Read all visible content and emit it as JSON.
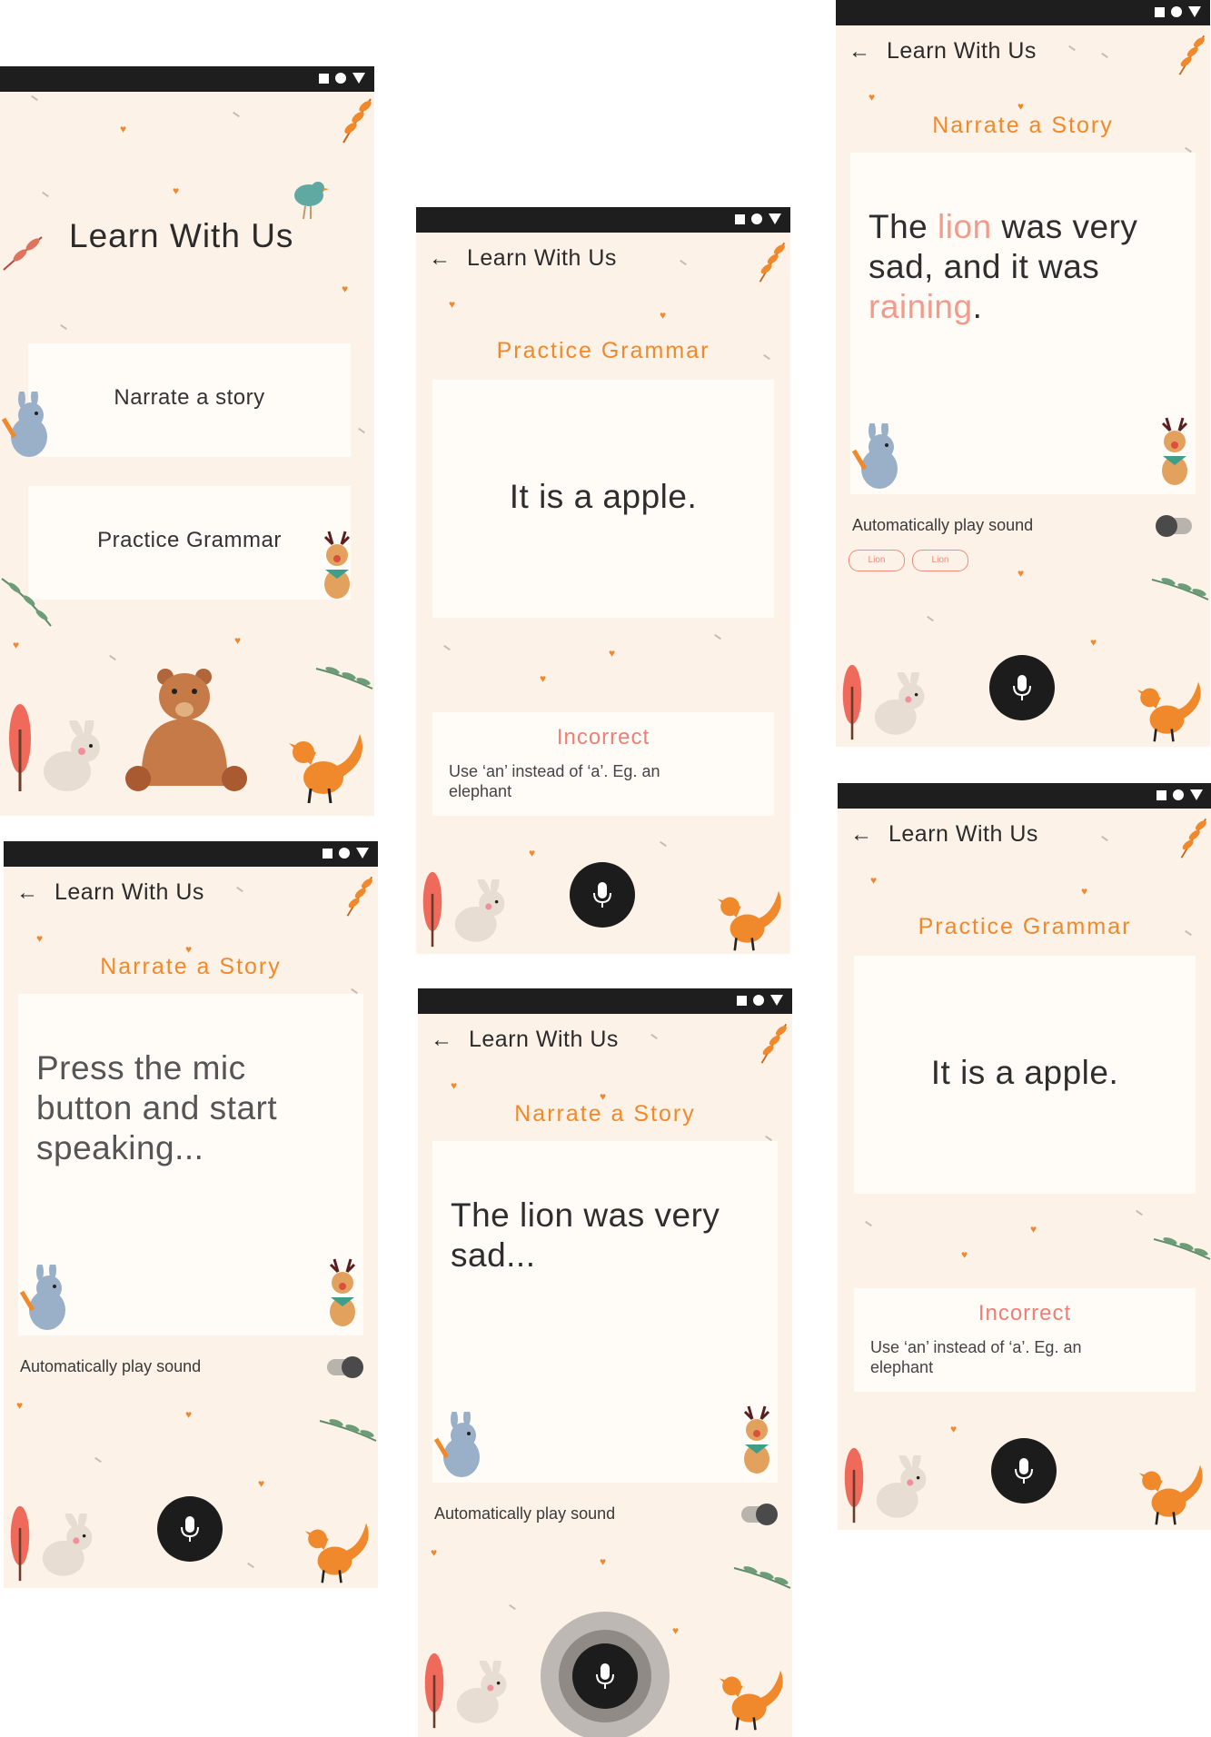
{
  "app_title": "Learn With Us",
  "home": {
    "title": "Learn With Us",
    "menu": [
      "Narrate a story",
      "Practice Grammar"
    ]
  },
  "narrate_title": "Narrate a Story",
  "grammar_title": "Practice Grammar",
  "narrate_prompt": "Press the mic button and start speaking...",
  "narrate_partial": "The lion was very sad...",
  "narrate_full": {
    "part1": "The ",
    "word1": "lion",
    "part2": " was very sad, and it was ",
    "word2": "raining",
    "part3": "."
  },
  "chips": [
    "Lion",
    "Lion"
  ],
  "grammar_sentence": "It is a apple.",
  "feedback": {
    "title": "Incorrect",
    "body": "Use ‘an’ instead of ‘a’. Eg. an elephant"
  },
  "toggle_label": "Automatically play sound",
  "icons": {
    "back": "arrow-left-icon",
    "mic": "microphone-icon",
    "status": [
      "square-icon",
      "circle-icon",
      "triangle-icon"
    ]
  },
  "colors": {
    "accent": "#f0892b",
    "error": "#f07e74",
    "background": "#fdf2e7",
    "card": "#fffcf7",
    "dark": "#1c1c1c"
  }
}
